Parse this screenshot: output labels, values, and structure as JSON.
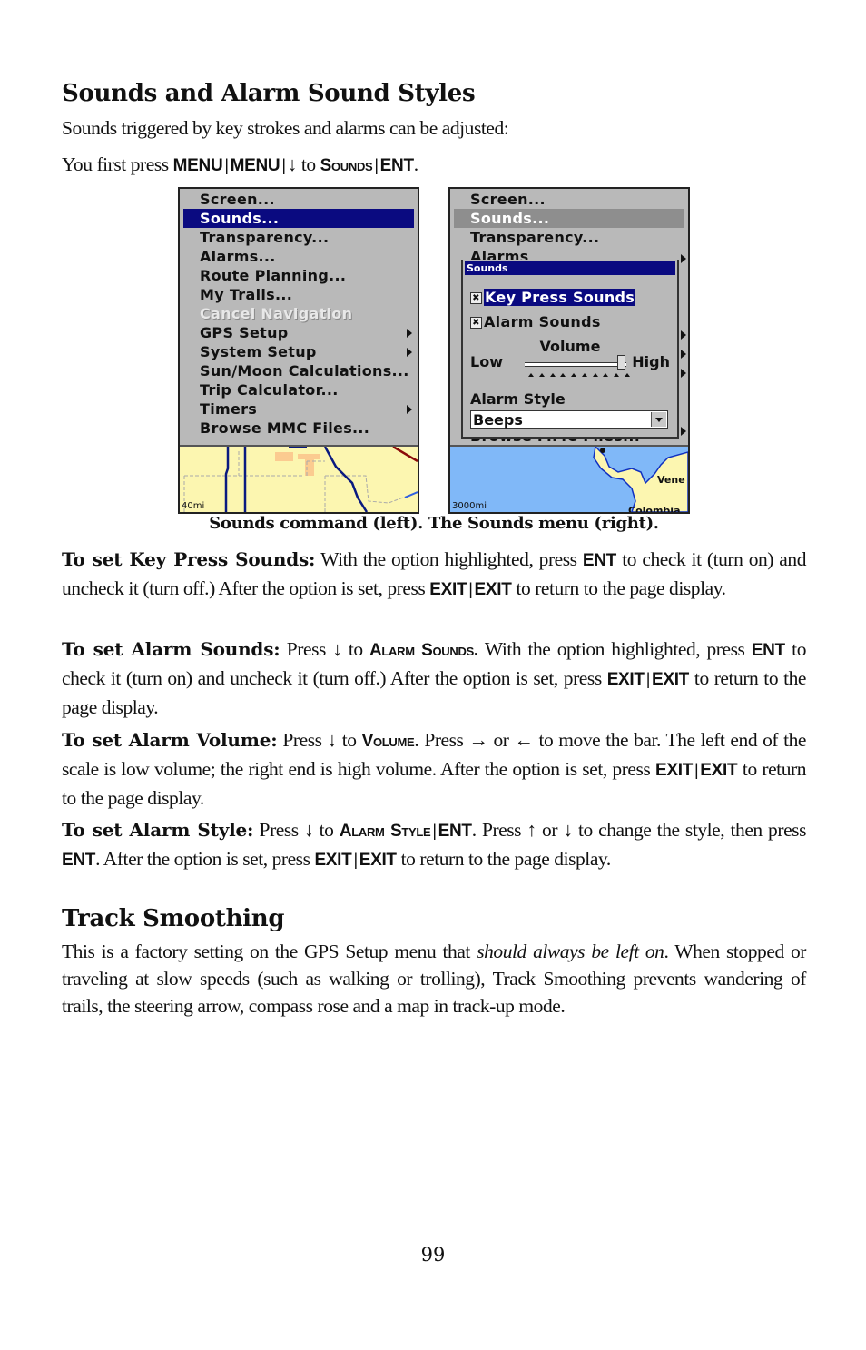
{
  "section1": {
    "title": "Sounds and Alarm Sound Styles",
    "intro": "Sounds triggered by key strokes and alarms can be adjusted:",
    "first_press": {
      "prefix": "You first press ",
      "key1": "MENU",
      "sep": "|",
      "key2": "MENU",
      "arrow": "↓",
      "to": " to ",
      "target": "Sounds",
      "key3": "ENT",
      "end": "."
    }
  },
  "figure": {
    "left_screen": {
      "menu_items": [
        {
          "label": "Screen..."
        },
        {
          "label": "Sounds...",
          "state": "selected"
        },
        {
          "label": "Transparency..."
        },
        {
          "label": "Alarms..."
        },
        {
          "label": "Route Planning..."
        },
        {
          "label": "My Trails..."
        },
        {
          "label": "Cancel Navigation",
          "state": "disabled"
        },
        {
          "label": "GPS Setup",
          "submenu": true
        },
        {
          "label": "System Setup",
          "submenu": true
        },
        {
          "label": "Sun/Moon Calculations..."
        },
        {
          "label": "Trip Calculator..."
        },
        {
          "label": "Timers",
          "submenu": true
        },
        {
          "label": "Browse MMC Files..."
        }
      ],
      "map_scale": "40mi"
    },
    "right_screen": {
      "menu_items": [
        {
          "label": "Screen..."
        },
        {
          "label": "Sounds...",
          "state": "active"
        },
        {
          "label": "Transparency..."
        },
        {
          "label": "Alarms"
        }
      ],
      "bottom_item": "Browse MMC Files...",
      "dialog": {
        "title": "Sounds",
        "key_press_sounds": {
          "label": "Key Press Sounds",
          "checked": true,
          "check_glyph": "✖"
        },
        "alarm_sounds": {
          "label": "Alarm Sounds",
          "checked": true,
          "check_glyph": "✖"
        },
        "volume_title": "Volume",
        "volume_low": "Low",
        "volume_high": "High",
        "volume_level": 0.95,
        "alarm_style_label": "Alarm Style",
        "alarm_style_value": "Beeps"
      },
      "map_scale": "3000mi",
      "map_labels": [
        "Vene",
        "Colombia"
      ]
    },
    "caption": "Sounds command (left). The Sounds menu (right)."
  },
  "paragraphs": {
    "key_press": {
      "lead": "To set Key Press Sounds:",
      "t1": " With the option highlighted, press ",
      "k1": "ENT",
      "t2": " to check it (turn on) and uncheck it (turn off.) After the option is set, press ",
      "k2": "EXIT",
      "sep": "|",
      "k3": "EXIT",
      "t3": " to return to the page display."
    },
    "alarm_sounds": {
      "lead": "To set Alarm Sounds:",
      "t1": " Press ↓ to ",
      "sc1": "Alarm Sounds.",
      "t2": " With the option highlighted, press ",
      "k1": "ENT",
      "t3": " to check it (turn on) and uncheck it (turn off.) After the option is set, press ",
      "k2": "EXIT",
      "sep": "|",
      "k3": "EXIT",
      "t4": " to return to the page display."
    },
    "alarm_volume": {
      "lead": "To set Alarm Volume:",
      "t1": " Press ↓ to ",
      "sc1": "Volume",
      "t2": ". Press → or ←  to move the bar. The left end of the scale is low volume; the right end is high volume. After the option is set, press ",
      "k1": "EXIT",
      "sep": "|",
      "k2": "EXIT",
      "t3": " to return to the page display."
    },
    "alarm_style": {
      "lead": "To set Alarm Style:",
      "t1": " Press ↓ to ",
      "sc1": "Alarm Style",
      "sep": "|",
      "k1": "ENT",
      "t2": ". Press ↑ or ↓ to change the style, then press ",
      "k2": "ENT",
      "t3": ". After the option is set, press ",
      "k3": "EXIT",
      "k4": "EXIT",
      "t4": " to return to the page display."
    }
  },
  "section2": {
    "title": "Track Smoothing",
    "t1": "This is a factory setting on the GPS Setup menu that ",
    "em": "should always be left on",
    "t2": ". When stopped or traveling at slow speeds (such as walking or trolling), Track Smoothing prevents wandering of trails, the steering arrow, compass rose and a map in track-up mode."
  },
  "page_number": "99",
  "colors": {
    "menu_bg": "#b9b9b9",
    "highlight": "#0a0a80",
    "map_land": "#fcf6b0",
    "map_water": "#80b8f8"
  }
}
